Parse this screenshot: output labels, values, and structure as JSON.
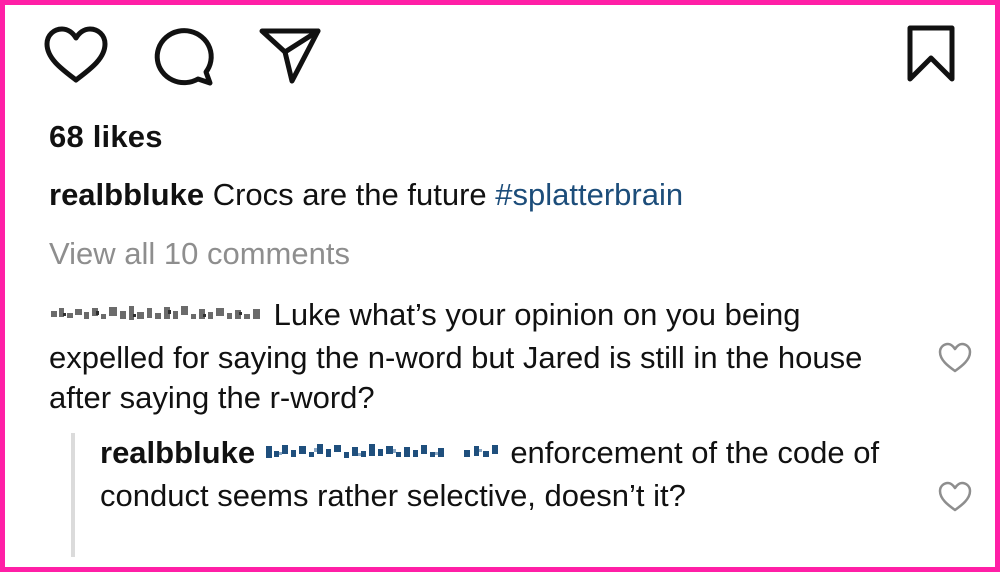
{
  "post": {
    "likes": "68 likes",
    "caption": {
      "username": "realbbluke",
      "text": "Crocs are the future",
      "hashtag": "#splatterbrain"
    },
    "view_all_comments": "View all 10 comments"
  },
  "comments": [
    {
      "username_redacted": true,
      "text": "Luke what’s your opinion on you being expelled for saying the n-word but Jared is still in the house after saying the r-word?"
    }
  ],
  "replies": [
    {
      "username": "realbbluke",
      "mention_redacted": true,
      "text": "enforcement of the code of conduct seems rather selective, doesn’t it?"
    }
  ],
  "icons": {
    "like": "heart-icon",
    "comment": "comment-icon",
    "share": "paper-plane-icon",
    "save": "bookmark-icon",
    "comment_like": "heart-outline-small-icon"
  },
  "colors": {
    "frame_border": "#ff1fa6",
    "hashtag": "#1c4d7a",
    "muted_text": "#8e8e8e",
    "redaction_blue": "#1f4f7d"
  }
}
